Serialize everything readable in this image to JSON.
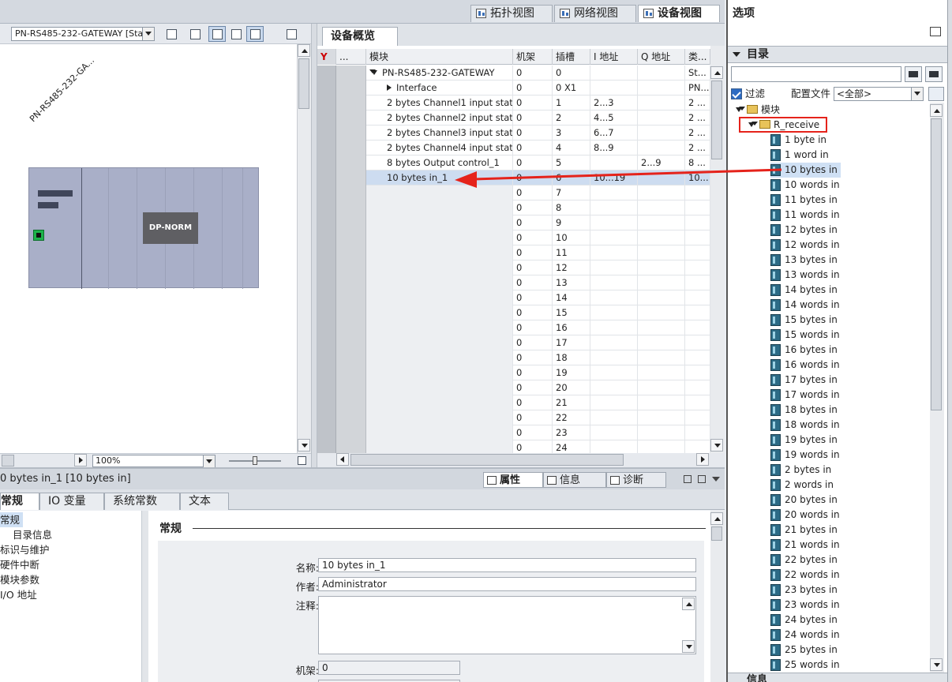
{
  "view_tabs": [
    {
      "label": "拓扑视图",
      "active": false
    },
    {
      "label": "网络视图",
      "active": false
    },
    {
      "label": "设备视图",
      "active": true
    }
  ],
  "graphic": {
    "device_select": "PN-RS485-232-GATEWAY [Star",
    "rack_label": "PN-RS485-232-GA...",
    "module_label": "DP-NORM",
    "zoom": "100%"
  },
  "overview": {
    "tab_label": "设备概览",
    "columns": [
      "模块",
      "机架",
      "插槽",
      "I 地址",
      "Q 地址",
      "类..."
    ],
    "rows": [
      {
        "module": "PN-RS485-232-GATEWAY",
        "rack": "0",
        "slot": "0",
        "iaddr": "",
        "qaddr": "",
        "type": "St...",
        "expand": "down",
        "level": 0
      },
      {
        "module": "Interface",
        "rack": "0",
        "slot": "0 X1",
        "iaddr": "",
        "qaddr": "",
        "type": "PN...",
        "expand": "right",
        "level": 1
      },
      {
        "module": "2 bytes Channel1 input stat...",
        "rack": "0",
        "slot": "1",
        "iaddr": "2...3",
        "qaddr": "",
        "type": "2 ...",
        "level": 0
      },
      {
        "module": "2 bytes Channel2 input stat...",
        "rack": "0",
        "slot": "2",
        "iaddr": "4...5",
        "qaddr": "",
        "type": "2 ...",
        "level": 0
      },
      {
        "module": "2 bytes Channel3 input stat...",
        "rack": "0",
        "slot": "3",
        "iaddr": "6...7",
        "qaddr": "",
        "type": "2 ...",
        "level": 0
      },
      {
        "module": "2 bytes Channel4 input stat...",
        "rack": "0",
        "slot": "4",
        "iaddr": "8...9",
        "qaddr": "",
        "type": "2 ...",
        "level": 0
      },
      {
        "module": "8 bytes Output control_1",
        "rack": "0",
        "slot": "5",
        "iaddr": "",
        "qaddr": "2...9",
        "type": "8 ...",
        "level": 0
      },
      {
        "module": "10 bytes in_1",
        "rack": "0",
        "slot": "6",
        "iaddr": "10...19",
        "qaddr": "",
        "type": "10...",
        "level": 0,
        "selected": true
      },
      {
        "module": "",
        "rack": "0",
        "slot": "7"
      },
      {
        "module": "",
        "rack": "0",
        "slot": "8"
      },
      {
        "module": "",
        "rack": "0",
        "slot": "9"
      },
      {
        "module": "",
        "rack": "0",
        "slot": "10"
      },
      {
        "module": "",
        "rack": "0",
        "slot": "11"
      },
      {
        "module": "",
        "rack": "0",
        "slot": "12"
      },
      {
        "module": "",
        "rack": "0",
        "slot": "13"
      },
      {
        "module": "",
        "rack": "0",
        "slot": "14"
      },
      {
        "module": "",
        "rack": "0",
        "slot": "15"
      },
      {
        "module": "",
        "rack": "0",
        "slot": "16"
      },
      {
        "module": "",
        "rack": "0",
        "slot": "17"
      },
      {
        "module": "",
        "rack": "0",
        "slot": "18"
      },
      {
        "module": "",
        "rack": "0",
        "slot": "19"
      },
      {
        "module": "",
        "rack": "0",
        "slot": "20"
      },
      {
        "module": "",
        "rack": "0",
        "slot": "21"
      },
      {
        "module": "",
        "rack": "0",
        "slot": "22"
      },
      {
        "module": "",
        "rack": "0",
        "slot": "23"
      },
      {
        "module": "",
        "rack": "0",
        "slot": "24"
      }
    ]
  },
  "properties": {
    "title": "0 bytes in_1 [10 bytes in]",
    "panel_tabs": [
      "属性",
      "信息",
      "诊断"
    ],
    "sub_tabs": [
      "常规",
      "IO 变量",
      "系统常数",
      "文本"
    ],
    "nav": [
      "常规",
      "目录信息",
      "标识与维护",
      "硬件中断",
      "模块参数",
      "I/O 地址"
    ],
    "section_title": "常规",
    "fields": {
      "name_label": "名称:",
      "name_value": "10 bytes in_1",
      "author_label": "作者:",
      "author_value": "Administrator",
      "comment_label": "注释:",
      "comment_value": "",
      "rack_label": "机架:",
      "rack_value": "0"
    }
  },
  "options": {
    "title": "选项",
    "catalog_title": "目录",
    "search_placeholder": "",
    "filter_label": "过滤",
    "config_label": "配置文件",
    "config_value": "<全部>",
    "tree_root": "模块",
    "tree_folder": "R_receive",
    "items": [
      "1 byte in",
      "1 word in",
      "10 bytes in",
      "10 words in",
      "11 bytes in",
      "11 words in",
      "12 bytes in",
      "12 words in",
      "13 bytes in",
      "13 words in",
      "14 bytes in",
      "14 words in",
      "15 bytes in",
      "15 words in",
      "16 bytes in",
      "16 words in",
      "17 bytes in",
      "17 words in",
      "18 bytes in",
      "18 words in",
      "19 bytes in",
      "19 words in",
      "2 bytes in",
      "2 words in",
      "20 bytes in",
      "20 words in",
      "21 bytes in",
      "21 words in",
      "22 bytes in",
      "22 words in",
      "23 bytes in",
      "23 words in",
      "24 bytes in",
      "24 words in",
      "25 bytes in",
      "25 words in"
    ],
    "selected_item": "10 bytes in",
    "info_label": "信息"
  },
  "colors": {
    "highlight": "#e5231b",
    "selection": "#cddcf0"
  }
}
